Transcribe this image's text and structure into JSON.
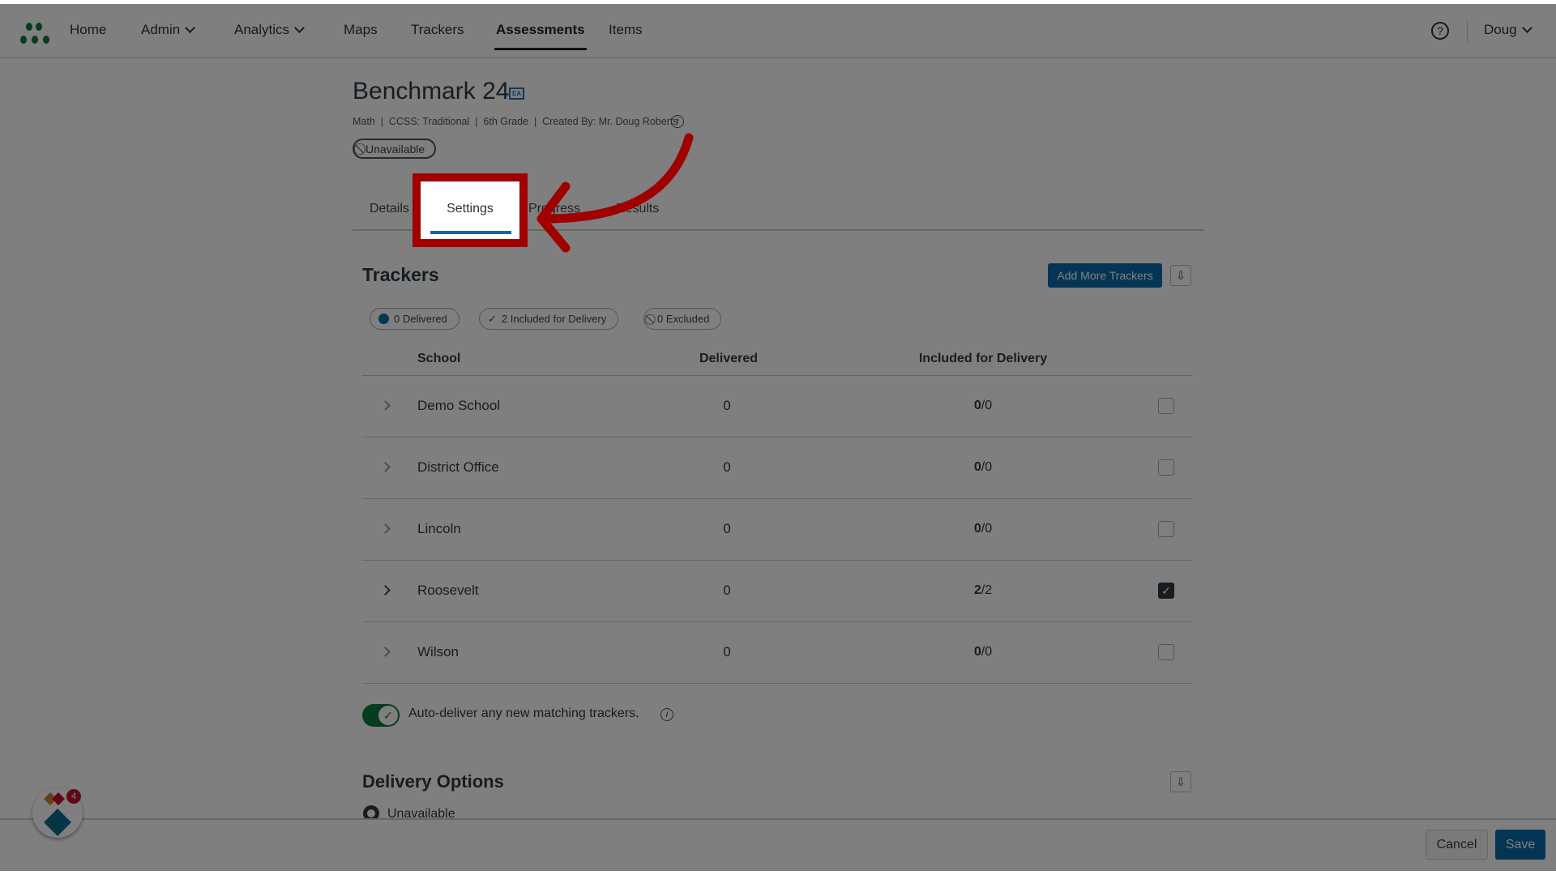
{
  "nav": {
    "items": [
      {
        "label": "Home"
      },
      {
        "label": "Admin",
        "dropdown": true
      },
      {
        "label": "Analytics",
        "dropdown": true
      },
      {
        "label": "Maps"
      },
      {
        "label": "Trackers"
      },
      {
        "label": "Assessments",
        "active": true
      },
      {
        "label": "Items"
      }
    ],
    "user": "Doug",
    "help_icon": "question-circle-icon"
  },
  "assessment": {
    "title": "Benchmark 24",
    "badge": "EA",
    "meta": "Math  |  CCSS: Traditional  |  6th Grade  |  Created By: Mr. Doug Roberts",
    "status": "Unavailable"
  },
  "tabs": [
    "Details",
    "Settings",
    "Progress",
    "Results"
  ],
  "active_tab": "Settings",
  "trackers": {
    "heading": "Trackers",
    "add_button": "Add More Trackers",
    "chips": [
      "0 Delivered",
      "2 Included for Delivery",
      "0 Excluded"
    ],
    "columns": [
      "School",
      "Delivered",
      "Included for Delivery"
    ],
    "rows": [
      {
        "school": "Demo School",
        "delivered": "0",
        "included": "0",
        "total": "/0",
        "checked": false
      },
      {
        "school": "District Office",
        "delivered": "0",
        "included": "0",
        "total": "/0",
        "checked": false
      },
      {
        "school": "Lincoln",
        "delivered": "0",
        "included": "0",
        "total": "/0",
        "checked": false
      },
      {
        "school": "Roosevelt",
        "delivered": "0",
        "included": "2",
        "total": "/2",
        "checked": true
      },
      {
        "school": "Wilson",
        "delivered": "0",
        "included": "0",
        "total": "/0",
        "checked": false
      }
    ],
    "auto_deliver": {
      "label": "Auto-deliver any new matching trackers.",
      "on": true
    }
  },
  "delivery": {
    "heading": "Delivery Options",
    "option": "Unavailable"
  },
  "footer": {
    "cancel": "Cancel",
    "save": "Save"
  },
  "widget": {
    "badge": "4"
  },
  "colors": {
    "highlight": "#a00000",
    "accent": "#0b6aa8",
    "toggle": "#0a7a3a"
  }
}
